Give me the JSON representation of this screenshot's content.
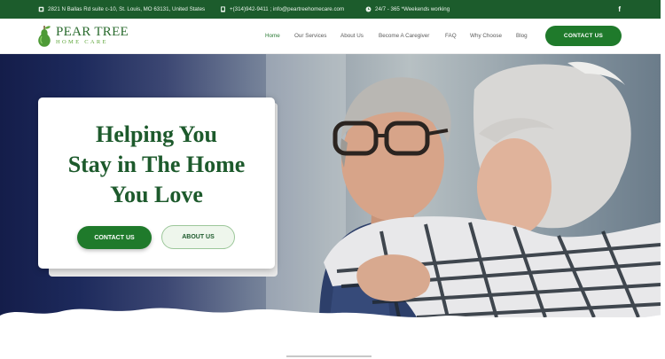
{
  "topbar": {
    "address": "2821 N Ballas Rd suite c-10, St. Louis, MO 63131, United States",
    "contact": "+(314)942-9411 ; info@peartreehomecare.com",
    "hours": "24/7 - 365 *Weekends working",
    "social_icon": "f"
  },
  "logo": {
    "main": "PEAR TREE",
    "sub": "HOME CARE"
  },
  "nav": {
    "items": [
      "Home",
      "Our Services",
      "About Us",
      "Become A Caregiver",
      "FAQ",
      "Why Choose",
      "Blog"
    ],
    "cta": "CONTACT US"
  },
  "hero": {
    "headline_1": "Helping You",
    "headline_2": "Stay in The Home",
    "headline_3": "You Love",
    "contact_button": "CONTACT US",
    "about_button": "ABOUT US"
  },
  "colors": {
    "brand_green": "#1f7a2b",
    "topbar_green": "#1c5c2c",
    "headline_green": "#1d5a2c"
  }
}
